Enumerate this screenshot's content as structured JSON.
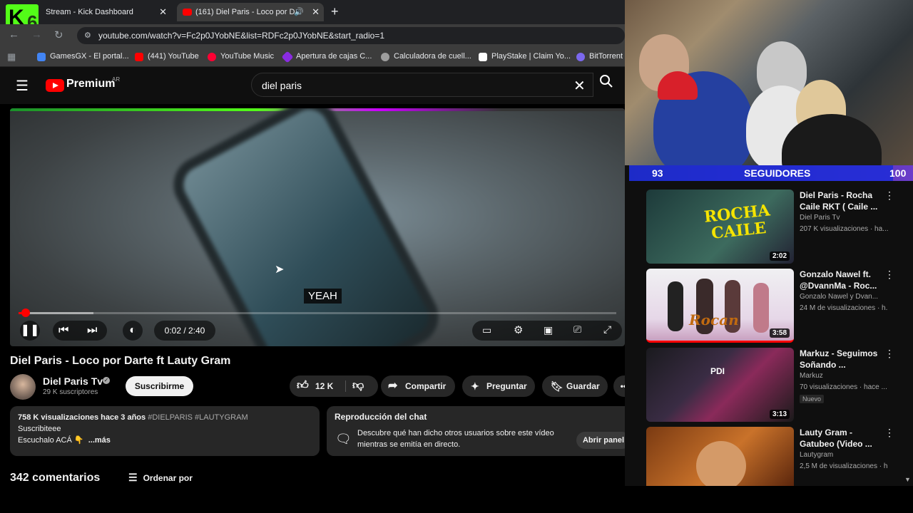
{
  "browser": {
    "tabs": [
      {
        "title": "Stream - Kick Dashboard"
      },
      {
        "title": "(161) Diel Paris - Loco por D"
      }
    ],
    "new_tab": "+",
    "url": "youtube.com/watch?v=Fc2p0JYobNE&list=RDFc2p0JYobNE&start_radio=1",
    "bookmarks": [
      {
        "label": "GamesGX - El portal...",
        "color": "#4285f4"
      },
      {
        "label": "(441) YouTube",
        "color": "#ff0000"
      },
      {
        "label": "YouTube Music",
        "color": "#ff0033"
      },
      {
        "label": "Apertura de cajas C...",
        "color": "#8a2be2"
      },
      {
        "label": "Calculadora de cuell...",
        "color": "#9e9e9e"
      },
      {
        "label": "PlayStake | Claim Yo...",
        "color": "#ffffff"
      },
      {
        "label": "BitTorrent",
        "color": "#7b68ee"
      }
    ]
  },
  "youtube": {
    "logo": "Premium",
    "region": "AR",
    "search_value": "diel paris"
  },
  "player": {
    "caption": "YEAH",
    "time": "0:02 / 2:40",
    "progress_fraction": 0.0125,
    "buffer_fraction": 0.125
  },
  "video": {
    "title": "Diel Paris - Loco por Darte ft Lauty Gram",
    "channel": "Diel Paris Tv",
    "subscribers": "29 K suscriptores",
    "subscribe_label": "Suscribirme",
    "likes": "12 K",
    "share": "Compartir",
    "ask": "Preguntar",
    "save": "Guardar",
    "description": {
      "stats": "758 K visualizaciones  hace 3 años",
      "tags": "#DIELPARIS #LAUTYGRAM",
      "line2": "Suscribiteee",
      "line3": "Escuchalo ACÁ 👇",
      "more": "...más"
    },
    "chat": {
      "title": "Reproducción del chat",
      "text": "Descubre qué han dicho otros usuarios sobre este vídeo mientras se emitía en directo.",
      "button": "Abrir panel"
    },
    "comments_count": "342 comentarios",
    "sort_label": "Ordenar por"
  },
  "stream_overlay": {
    "goal_current": "93",
    "goal_label": "SEGUIDORES",
    "goal_target": "100",
    "goal_fraction": 0.93,
    "accent": "#53fc18"
  },
  "recommendations": [
    {
      "title": "Diel Paris - Rocha Caile RKT ( Caile ...",
      "channel": "Diel Paris Tv",
      "meta": "207 K visualizaciones · ha...",
      "duration": "2:02",
      "thumb_text": "ROCHA CAILE"
    },
    {
      "title": "Gonzalo Nawel ft. @DvannMa - Roc...",
      "channel": "Gonzalo Nawel  y Dvan...",
      "meta": "24 M de visualizaciones · h.",
      "duration": "3:58",
      "thumb_text": "Rocan"
    },
    {
      "title": "Markuz - Seguimos Soñando ...",
      "channel": "Markuz",
      "meta": "70 visualizaciones · hace ...",
      "duration": "3:13",
      "badge": "Nuevo",
      "thumb_text": "PDI"
    },
    {
      "title": "Lauty Gram - Gatubeo  (Video ...",
      "channel": "Lautygram",
      "meta": "2,5 M de visualizaciones · h",
      "duration": "",
      "thumb_text": ""
    }
  ]
}
